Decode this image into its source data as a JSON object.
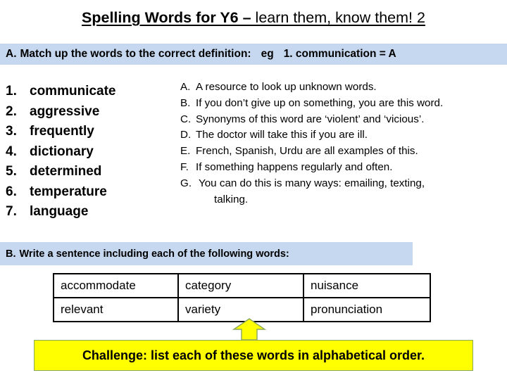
{
  "title": {
    "bold_part": "Spelling Words for Y6 – ",
    "plain_part": "learn them, know them!  2"
  },
  "section_a": {
    "letter": "A.",
    "instruction": "Match up the words to the correct definition:",
    "example_label": "eg",
    "example": "1. communication = A"
  },
  "words": [
    {
      "num": "1.",
      "word": "communicate"
    },
    {
      "num": "2.",
      "word": "aggressive"
    },
    {
      "num": "3.",
      "word": "frequently"
    },
    {
      "num": "4.",
      "word": "dictionary"
    },
    {
      "num": "5.",
      "word": "determined"
    },
    {
      "num": "6.",
      "word": "temperature"
    },
    {
      "num": "7.",
      "word": "language"
    }
  ],
  "definitions": [
    {
      "letter": "A.",
      "text": "A resource to look up unknown words."
    },
    {
      "letter": "B.",
      "text": "If you don’t give up on something, you are this word."
    },
    {
      "letter": "C.",
      "text": "Synonyms of this word are ‘violent’ and ‘vicious’."
    },
    {
      "letter": "D.",
      "text": "The doctor will take this if you are ill."
    },
    {
      "letter": "E.",
      "text": "French, Spanish, Urdu are all examples of this."
    },
    {
      "letter": "F.",
      "text": "If something happens regularly and often."
    },
    {
      "letter": "G.",
      "text": "You can do this is many ways: emailing, texting,",
      "continuation": "talking."
    }
  ],
  "section_b": {
    "letter": "B.",
    "instruction": "Write a sentence including each of the following words",
    "colon": ":"
  },
  "table": {
    "rows": [
      [
        "accommodate",
        "category",
        "nuisance"
      ],
      [
        "relevant",
        "variety",
        "pronunciation"
      ]
    ]
  },
  "challenge": {
    "text": "Challenge: list each of these words in alphabetical order."
  },
  "icons": {
    "arrow": "up-arrow-icon"
  },
  "colors": {
    "bar_blue": "#c5d8ef",
    "challenge_yellow": "#ffff00",
    "challenge_border": "#8aa75b",
    "arrow_fill": "#ffff00",
    "arrow_stroke": "#8aa75b"
  }
}
